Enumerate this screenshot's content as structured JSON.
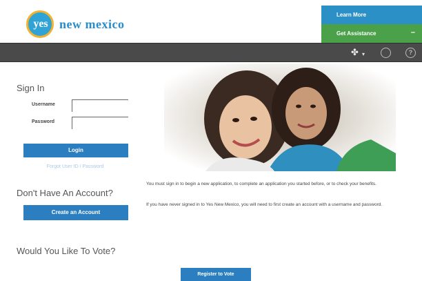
{
  "header": {
    "logo_yes": "yes",
    "logo_name": "new mexico",
    "learn_more": "Learn More",
    "get_assistance": "Get Assistance",
    "assistance_toggle": "–"
  },
  "nav": {
    "icons": [
      "pin-icon",
      "chat-icon",
      "help-icon"
    ],
    "dropdown_caret": "▾"
  },
  "signin": {
    "title": "Sign In",
    "username_label": "Username",
    "password_label": "Password",
    "username_value": "",
    "password_value": "",
    "login_label": "Login",
    "forgot_label": "Forgot User ID / Password"
  },
  "account": {
    "title": "Don't Have An Account?",
    "create_label": "Create an Account"
  },
  "vote": {
    "title": "Would You Like To Vote?",
    "register_label": "Register to Vote"
  },
  "info": {
    "line1": "You must sign in to begin a new application, to complete an application you started before, or to check your benefits.",
    "line2": "If you have never signed in to Yes New Mexico, you will need to first create an account with a username and password."
  },
  "colors": {
    "brand_blue": "#2b7fc0",
    "learn_more_bg": "#2b90c6",
    "assistance_bg": "#4aa14a",
    "navbar_bg": "#4a4a4a",
    "logo_gold": "#f2b230"
  }
}
